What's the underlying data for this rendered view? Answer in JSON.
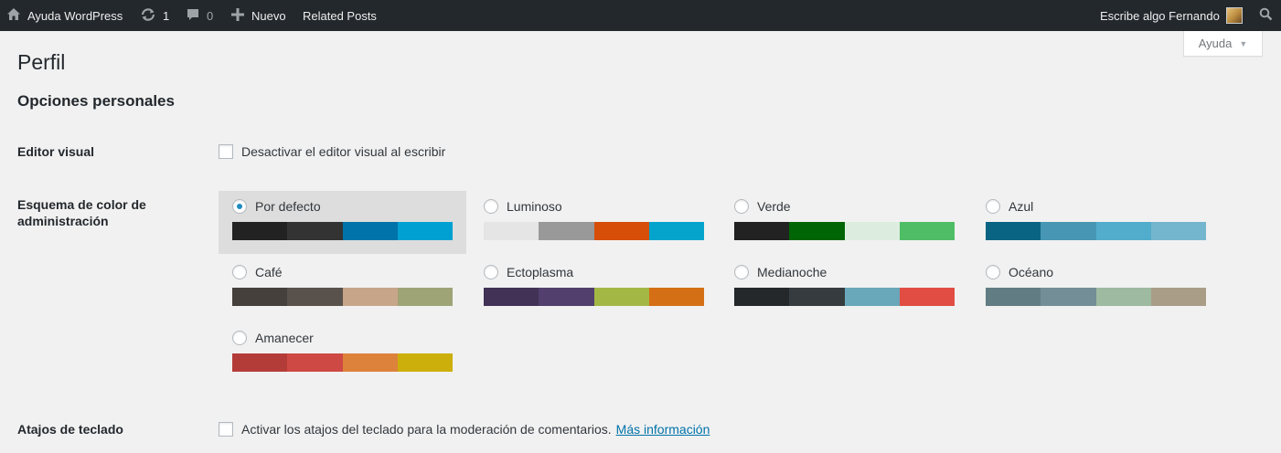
{
  "adminbar": {
    "site_name": "Ayuda WordPress",
    "updates_count": "1",
    "comments_count": "0",
    "new_label": "Nuevo",
    "related_posts_label": "Related Posts",
    "greeting": "Escribe algo Fernando",
    "icons": [
      "home-icon",
      "updates-icon",
      "comments-icon",
      "plus-icon",
      "search-icon"
    ]
  },
  "help_tab": {
    "label": "Ayuda"
  },
  "page": {
    "title": "Perfil",
    "section_title": "Opciones personales"
  },
  "visual_editor": {
    "label": "Editor visual",
    "checkbox_label": "Desactivar el editor visual al escribir",
    "checked": false
  },
  "color_scheme": {
    "label": "Esquema de color de administración",
    "selected": "Por defecto",
    "schemes": [
      {
        "name": "Por defecto",
        "colors": [
          "#222222",
          "#333333",
          "#0073aa",
          "#00a0d2"
        ]
      },
      {
        "name": "Luminoso",
        "colors": [
          "#e5e5e5",
          "#999999",
          "#d64e07",
          "#04a4cc"
        ]
      },
      {
        "name": "Verde",
        "colors": [
          "#222222",
          "#006505",
          "#dcede0",
          "#4fbd65"
        ]
      },
      {
        "name": "Azul",
        "colors": [
          "#096484",
          "#4796b3",
          "#52accc",
          "#74b6ce"
        ]
      },
      {
        "name": "Café",
        "colors": [
          "#46403c",
          "#59524c",
          "#c7a589",
          "#9ea476"
        ]
      },
      {
        "name": "Ectoplasma",
        "colors": [
          "#413256",
          "#523f6d",
          "#a3b745",
          "#d46f15"
        ]
      },
      {
        "name": "Medianoche",
        "colors": [
          "#25282b",
          "#363b3f",
          "#69a8bb",
          "#e14d43"
        ]
      },
      {
        "name": "Océano",
        "colors": [
          "#627c83",
          "#738e96",
          "#9ebaa0",
          "#aa9d88"
        ]
      },
      {
        "name": "Amanecer",
        "colors": [
          "#b43c38",
          "#cf4944",
          "#dd823b",
          "#ccaf0b"
        ]
      }
    ]
  },
  "keyboard_shortcuts": {
    "label": "Atajos de teclado",
    "checkbox_label": "Activar los atajos del teclado para la moderación de comentarios.",
    "link_text": "Más información",
    "checked": false
  }
}
